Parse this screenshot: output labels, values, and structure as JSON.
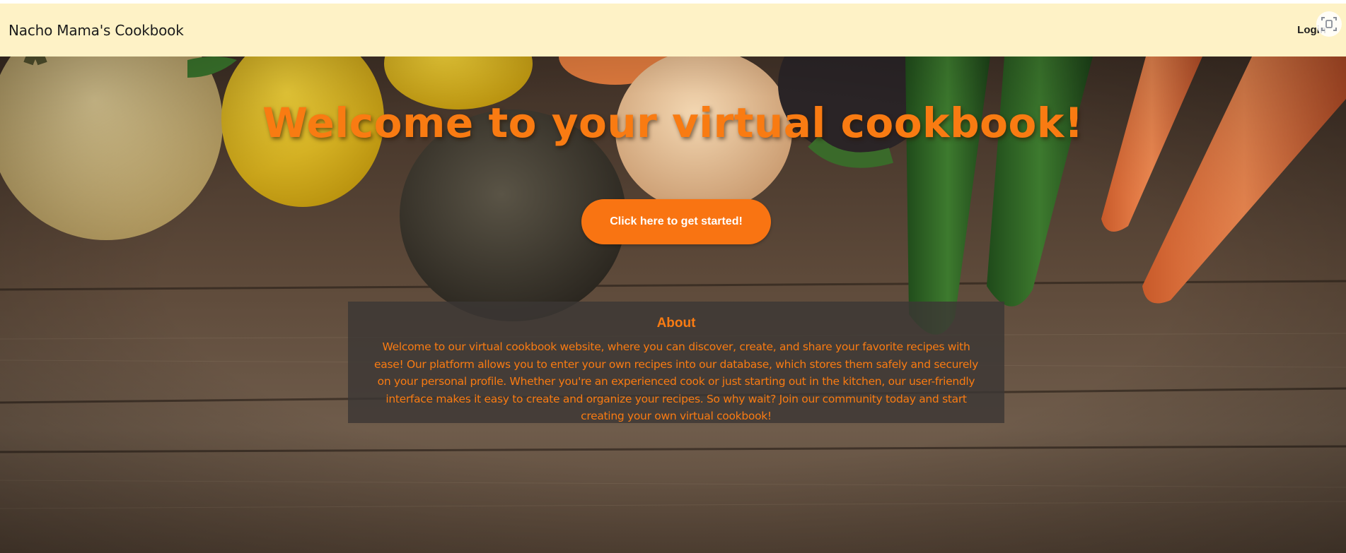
{
  "navbar": {
    "brand": "Nacho Mama's Cookbook",
    "login_label": "Login"
  },
  "hero": {
    "title": "Welcome to your virtual cookbook!",
    "cta_label": "Click here to get started!"
  },
  "about": {
    "title": "About",
    "text": "Welcome to our virtual cookbook website, where you can discover, create, and share your favorite recipes with ease! Our platform allows you to enter your own recipes into our database, which stores them safely and securely on your personal profile. Whether you're an experienced cook or just starting out in the kitchen, our user-friendly interface makes it easy to create and organize your recipes. So why wait? Join our community today and start creating your own virtual cookbook!"
  },
  "colors": {
    "navbar_bg": "#fef2c6",
    "accent": "#f97412",
    "about_bg": "#3c3734"
  },
  "icons": [
    "scan-icon",
    "background-vegetables-image"
  ]
}
